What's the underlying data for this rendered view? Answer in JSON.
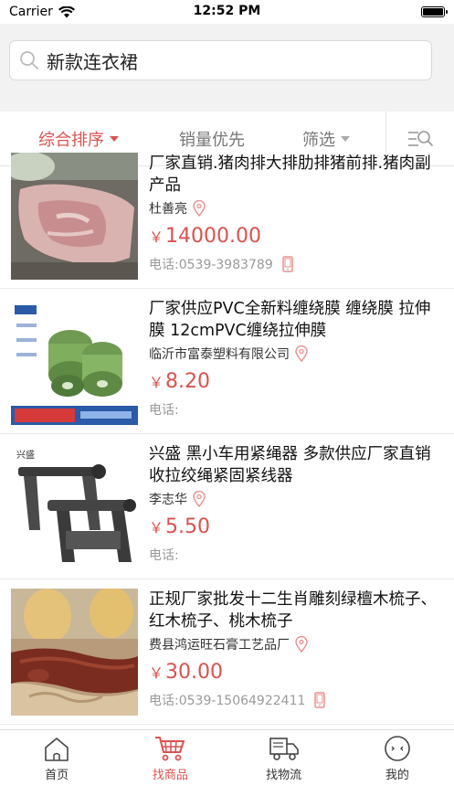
{
  "status": {
    "carrier": "Carrier",
    "time": "12:52 PM"
  },
  "search": {
    "query": "新款连衣裙"
  },
  "filters": {
    "sort": "综合排序",
    "sales": "销量优先",
    "filter": "筛选"
  },
  "phone_label": "电话:",
  "items": [
    {
      "title": "厂家直销.猪肉排大排肋排猪前排.猪肉副产品",
      "seller": "杜善亮",
      "price_symbol": "￥",
      "price": "14000.00",
      "phone": "0539-3983789"
    },
    {
      "title": "厂家供应PVC全新料缠绕膜 缠绕膜 拉伸膜 12cmPVC缠绕拉伸膜",
      "seller": "临沂市富泰塑料有限公司",
      "price_symbol": "￥",
      "price": "8.20",
      "phone": ""
    },
    {
      "title": "兴盛 黑小车用紧绳器 多款供应厂家直销收拉绞绳紧固紧线器",
      "seller": "李志华",
      "price_symbol": "￥",
      "price": "5.50",
      "phone": ""
    },
    {
      "title": "正规厂家批发十二生肖雕刻绿檀木梳子、红木梳子、桃木梳子",
      "seller": "费县鸿运旺石膏工艺品厂",
      "price_symbol": "￥",
      "price": "30.00",
      "phone": "0539-15064922411"
    }
  ],
  "tabs": [
    {
      "label": "首页"
    },
    {
      "label": "找商品"
    },
    {
      "label": "找物流"
    },
    {
      "label": "我的"
    }
  ],
  "colors": {
    "accent": "#d9534f",
    "muted": "#9a9a9a"
  }
}
